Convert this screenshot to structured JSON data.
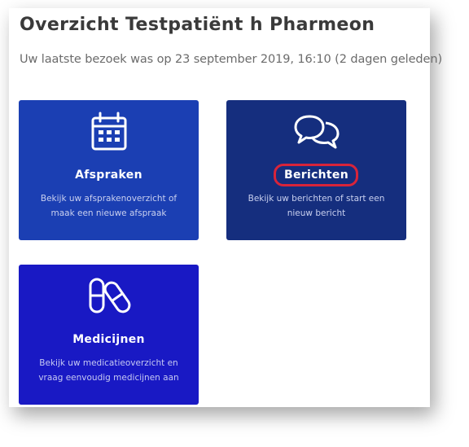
{
  "header": {
    "title": "Overzicht Testpatiënt h Pharmeon",
    "last_visit": "Uw laatste bezoek was op 23 september 2019, 16:10 (2 dagen geleden)"
  },
  "tiles": [
    {
      "label": "Afspraken",
      "description": "Bekijk uw afsprakenoverzicht of maak een nieuwe afspraak",
      "icon": "calendar-icon",
      "color": "#1b3fb3"
    },
    {
      "label": "Berichten",
      "description": "Bekijk uw berichten of start een nieuw bericht",
      "icon": "chat-bubbles-icon",
      "color": "#152e7e",
      "highlighted": true,
      "highlight_color": "#d8243a"
    },
    {
      "label": "Medicijnen",
      "description": "Bekijk uw medicatieoverzicht en vraag eenvoudig medicijnen aan",
      "icon": "pills-icon",
      "color": "#1919c4"
    }
  ]
}
